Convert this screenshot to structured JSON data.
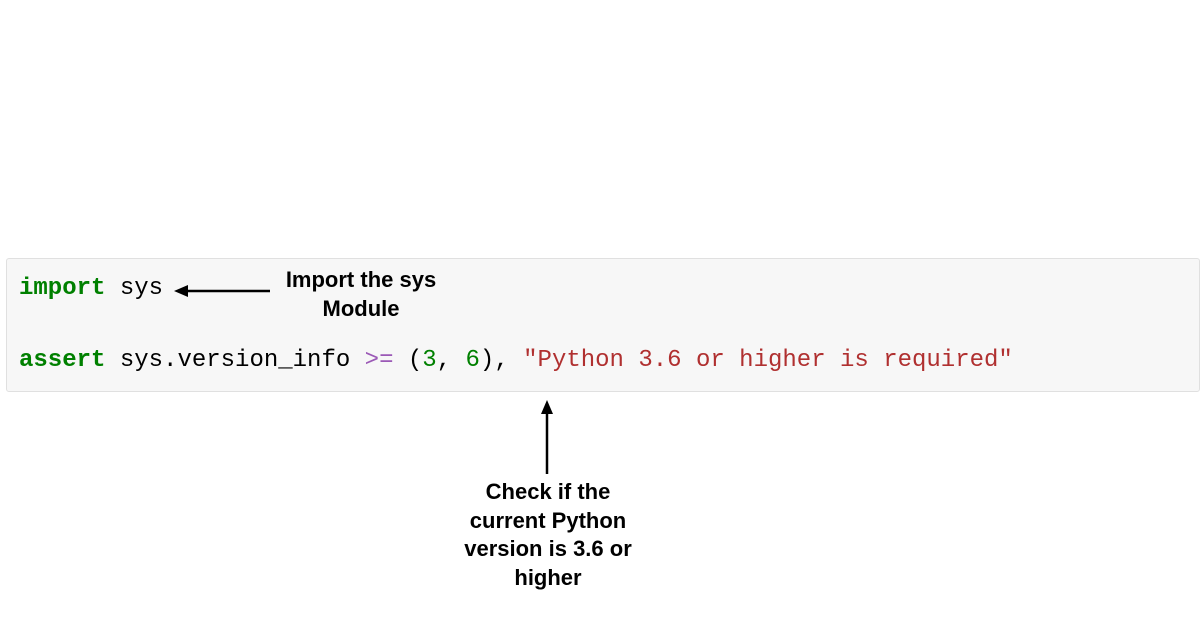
{
  "code": {
    "line1": {
      "keyword_import": "import",
      "space1": " ",
      "identifier_sys": "sys"
    },
    "line2": {
      "keyword_assert": "assert",
      "space1": " ",
      "expr1": "sys.version_info ",
      "op_gte": ">=",
      "space2": " ",
      "lparen": "(",
      "num1": "3",
      "comma1": ", ",
      "num2": "6",
      "rparen": ")",
      "comma2": ", ",
      "string": "\"Python 3.6 or higher is required\""
    }
  },
  "annotations": {
    "import_label_line1": "Import the sys",
    "import_label_line2": "Module",
    "assert_label_line1": "Check if the",
    "assert_label_line2": "current Python",
    "assert_label_line3": "version is 3.6 or",
    "assert_label_line4": "higher"
  },
  "colors": {
    "keyword": "#008000",
    "operator": "#9b59b6",
    "number": "#008000",
    "string": "#b03030",
    "text": "#000000",
    "codebg": "#f7f7f7"
  }
}
